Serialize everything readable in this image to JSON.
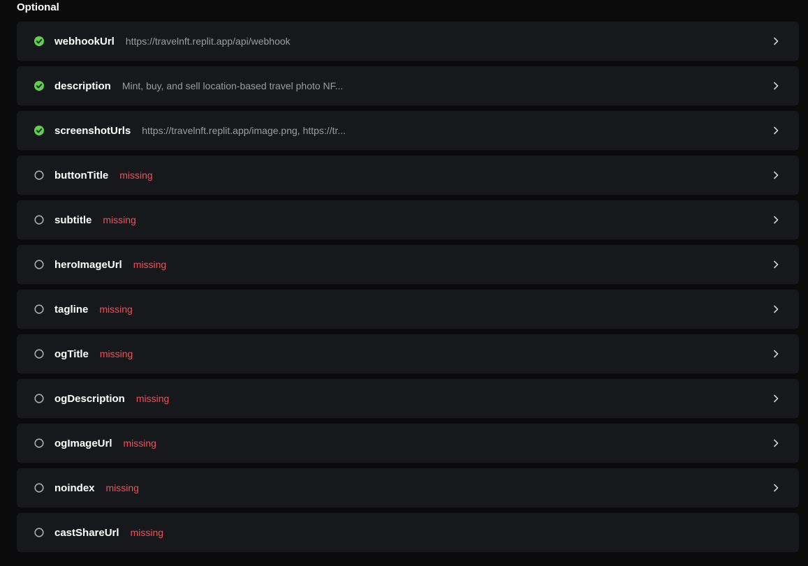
{
  "section": {
    "title": "Optional"
  },
  "colors": {
    "complete": "#5fcf4f",
    "missing": "#f0505a",
    "pending_ring": "#a9aab0"
  },
  "rows": [
    {
      "name": "webhookUrl",
      "value": "https://travelnft.replit.app/api/webhook",
      "status": "complete",
      "chevron": true
    },
    {
      "name": "description",
      "value": "Mint, buy, and sell location-based travel photo NF...",
      "status": "complete",
      "chevron": true
    },
    {
      "name": "screenshotUrls",
      "value": "https://travelnft.replit.app/image.png, https://tr...",
      "status": "complete",
      "chevron": true
    },
    {
      "name": "buttonTitle",
      "value": "missing",
      "status": "missing",
      "chevron": true
    },
    {
      "name": "subtitle",
      "value": "missing",
      "status": "missing",
      "chevron": true
    },
    {
      "name": "heroImageUrl",
      "value": "missing",
      "status": "missing",
      "chevron": true
    },
    {
      "name": "tagline",
      "value": "missing",
      "status": "missing",
      "chevron": true
    },
    {
      "name": "ogTitle",
      "value": "missing",
      "status": "missing",
      "chevron": true
    },
    {
      "name": "ogDescription",
      "value": "missing",
      "status": "missing",
      "chevron": true
    },
    {
      "name": "ogImageUrl",
      "value": "missing",
      "status": "missing",
      "chevron": true
    },
    {
      "name": "noindex",
      "value": "missing",
      "status": "missing",
      "chevron": true
    },
    {
      "name": "castShareUrl",
      "value": "missing",
      "status": "missing",
      "chevron": false
    }
  ],
  "icons": {
    "complete": "check-circle-icon",
    "missing": "empty-circle-icon",
    "chevron": "chevron-right-icon"
  }
}
